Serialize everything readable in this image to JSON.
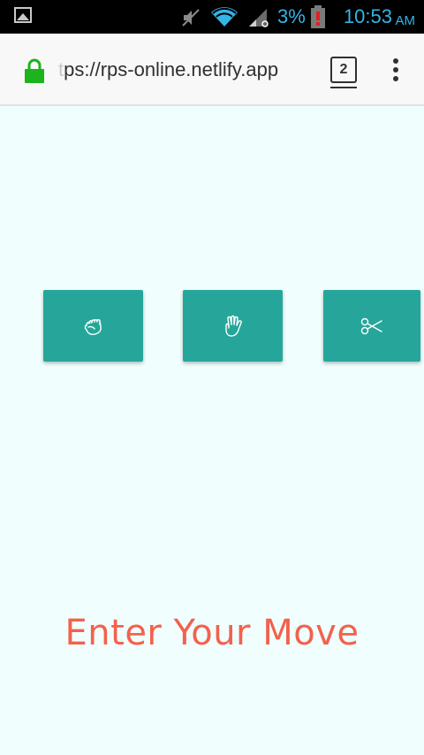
{
  "status_bar": {
    "battery_percent": "3%",
    "time": "10:53",
    "ampm": "AM",
    "icons": [
      "gallery-icon",
      "mute-icon",
      "wifi-icon",
      "signal-icon",
      "battery-alert-icon"
    ]
  },
  "browser": {
    "url_faded_prefix": "t",
    "url_text": "ps://rps-online.netlify.app",
    "tab_count": "2",
    "lock_color": "#1db31d"
  },
  "moves": [
    {
      "name": "rock",
      "icon": "fist-icon"
    },
    {
      "name": "paper",
      "icon": "hand-icon"
    },
    {
      "name": "scissors",
      "icon": "scissors-icon"
    }
  ],
  "prompt_text": "Enter Your Move",
  "colors": {
    "background": "#f0fefe",
    "button": "#26a69a",
    "prompt": "#f4614c",
    "status_accent": "#33b5e5"
  }
}
